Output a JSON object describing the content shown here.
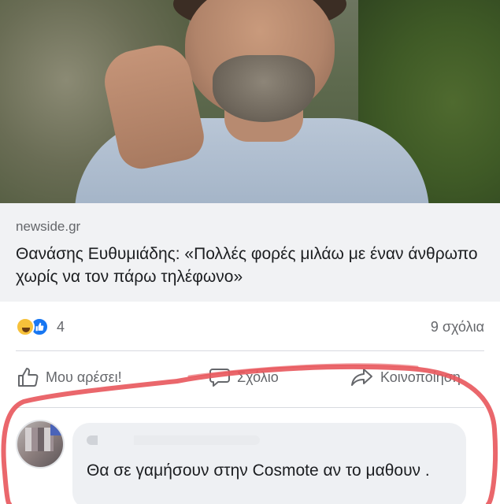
{
  "post": {
    "source": "newside.gr",
    "headline": "Θανάσης Ευθυμιάδης: «Πολλές φορές μιλάω με έναν άνθρωπο χωρίς να τον πάρω τηλέφωνο»"
  },
  "reactions": {
    "icons": [
      "haha-emoji-icon",
      "like-emoji-icon"
    ],
    "count": "4",
    "comments": "9 σχόλια"
  },
  "actions": {
    "like": "Μου αρέσει!",
    "comment": "Σχόλιο",
    "share": "Κοινοποίηση"
  },
  "comment": {
    "text": "Θα σε γαμήσουν στην Cosmote αν το μαθουν ."
  },
  "colors": {
    "preview_bg": "#f1f2f4",
    "text_primary": "#1c1e21",
    "text_secondary": "#65676b",
    "like_blue": "#1877f2",
    "annotation_red": "#e8575c"
  }
}
